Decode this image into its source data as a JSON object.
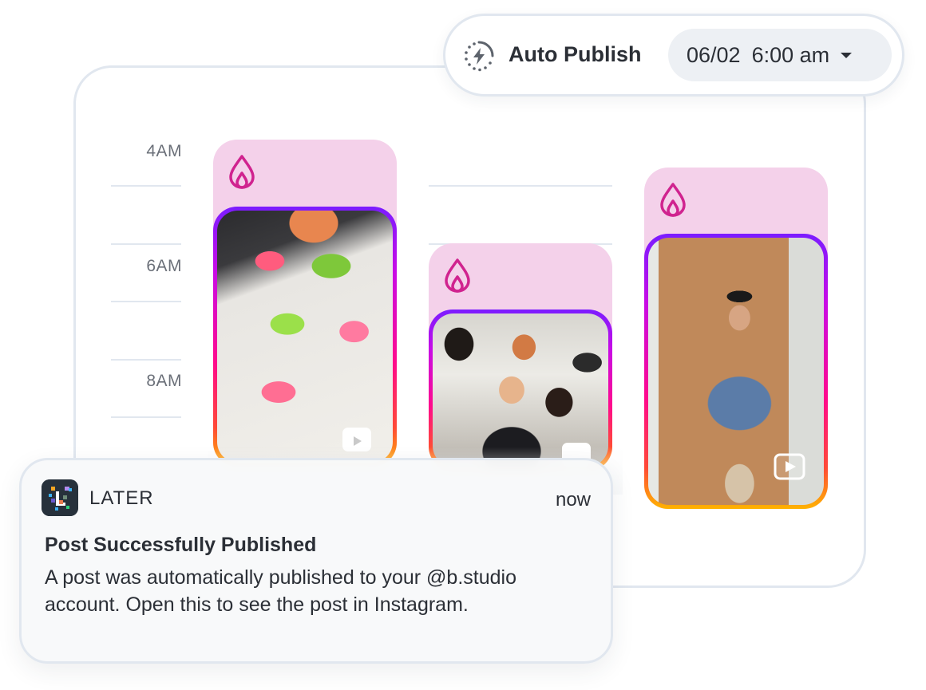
{
  "auto_publish": {
    "icon": "auto-publish-bolt-icon",
    "label": "Auto Publish",
    "date": "06/02",
    "time": "6:00 am",
    "caret_icon": "caret-down-icon"
  },
  "calendar": {
    "time_labels": [
      "4AM",
      "6AM",
      "8AM"
    ],
    "posts": [
      {
        "platform_icon": "flame-icon",
        "media_type_icon": "reels-icon"
      },
      {
        "platform_icon": "flame-icon",
        "media_type_icon": "reels-icon"
      },
      {
        "platform_icon": "flame-icon",
        "media_type_icon": "video-play-icon"
      }
    ]
  },
  "notification": {
    "app_icon": "later-logo-icon",
    "app_name": "LATER",
    "time": "now",
    "title": "Post Successfully Published",
    "body": "A post was automatically published to your @b.studio account. Open this to see the post in Instagram."
  },
  "colors": {
    "card_background": "#f4d1ea",
    "flame": "#d0238f",
    "border": "#e1e7ef",
    "text": "#2b2f36",
    "muted_text": "#6b7079"
  }
}
